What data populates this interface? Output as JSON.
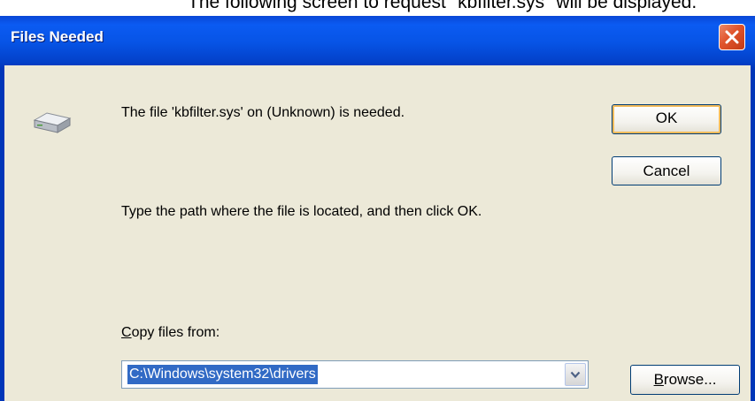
{
  "caption": {
    "text": "The following screen to request \"kbfilter.sys\" will be displayed."
  },
  "window": {
    "title": "Files Needed",
    "close_icon": "close-icon",
    "disk_icon": "disk-drive-icon",
    "message_file": "The file 'kbfilter.sys' on (Unknown) is needed.",
    "message_instruction": "Type the path where the file is located, and then click OK.",
    "copy_label_mnemonic": "C",
    "copy_label_rest": "opy files from:",
    "path_value": "C:\\Windows\\system32\\drivers",
    "ok_label": "OK",
    "cancel_label": "Cancel",
    "browse_mnemonic": "B",
    "browse_rest": "rowse..."
  },
  "colors": {
    "titlebar": "#0754e6",
    "dialog_bg": "#ece9d8",
    "selection": "#316ac5",
    "close_button": "#e0532b"
  }
}
